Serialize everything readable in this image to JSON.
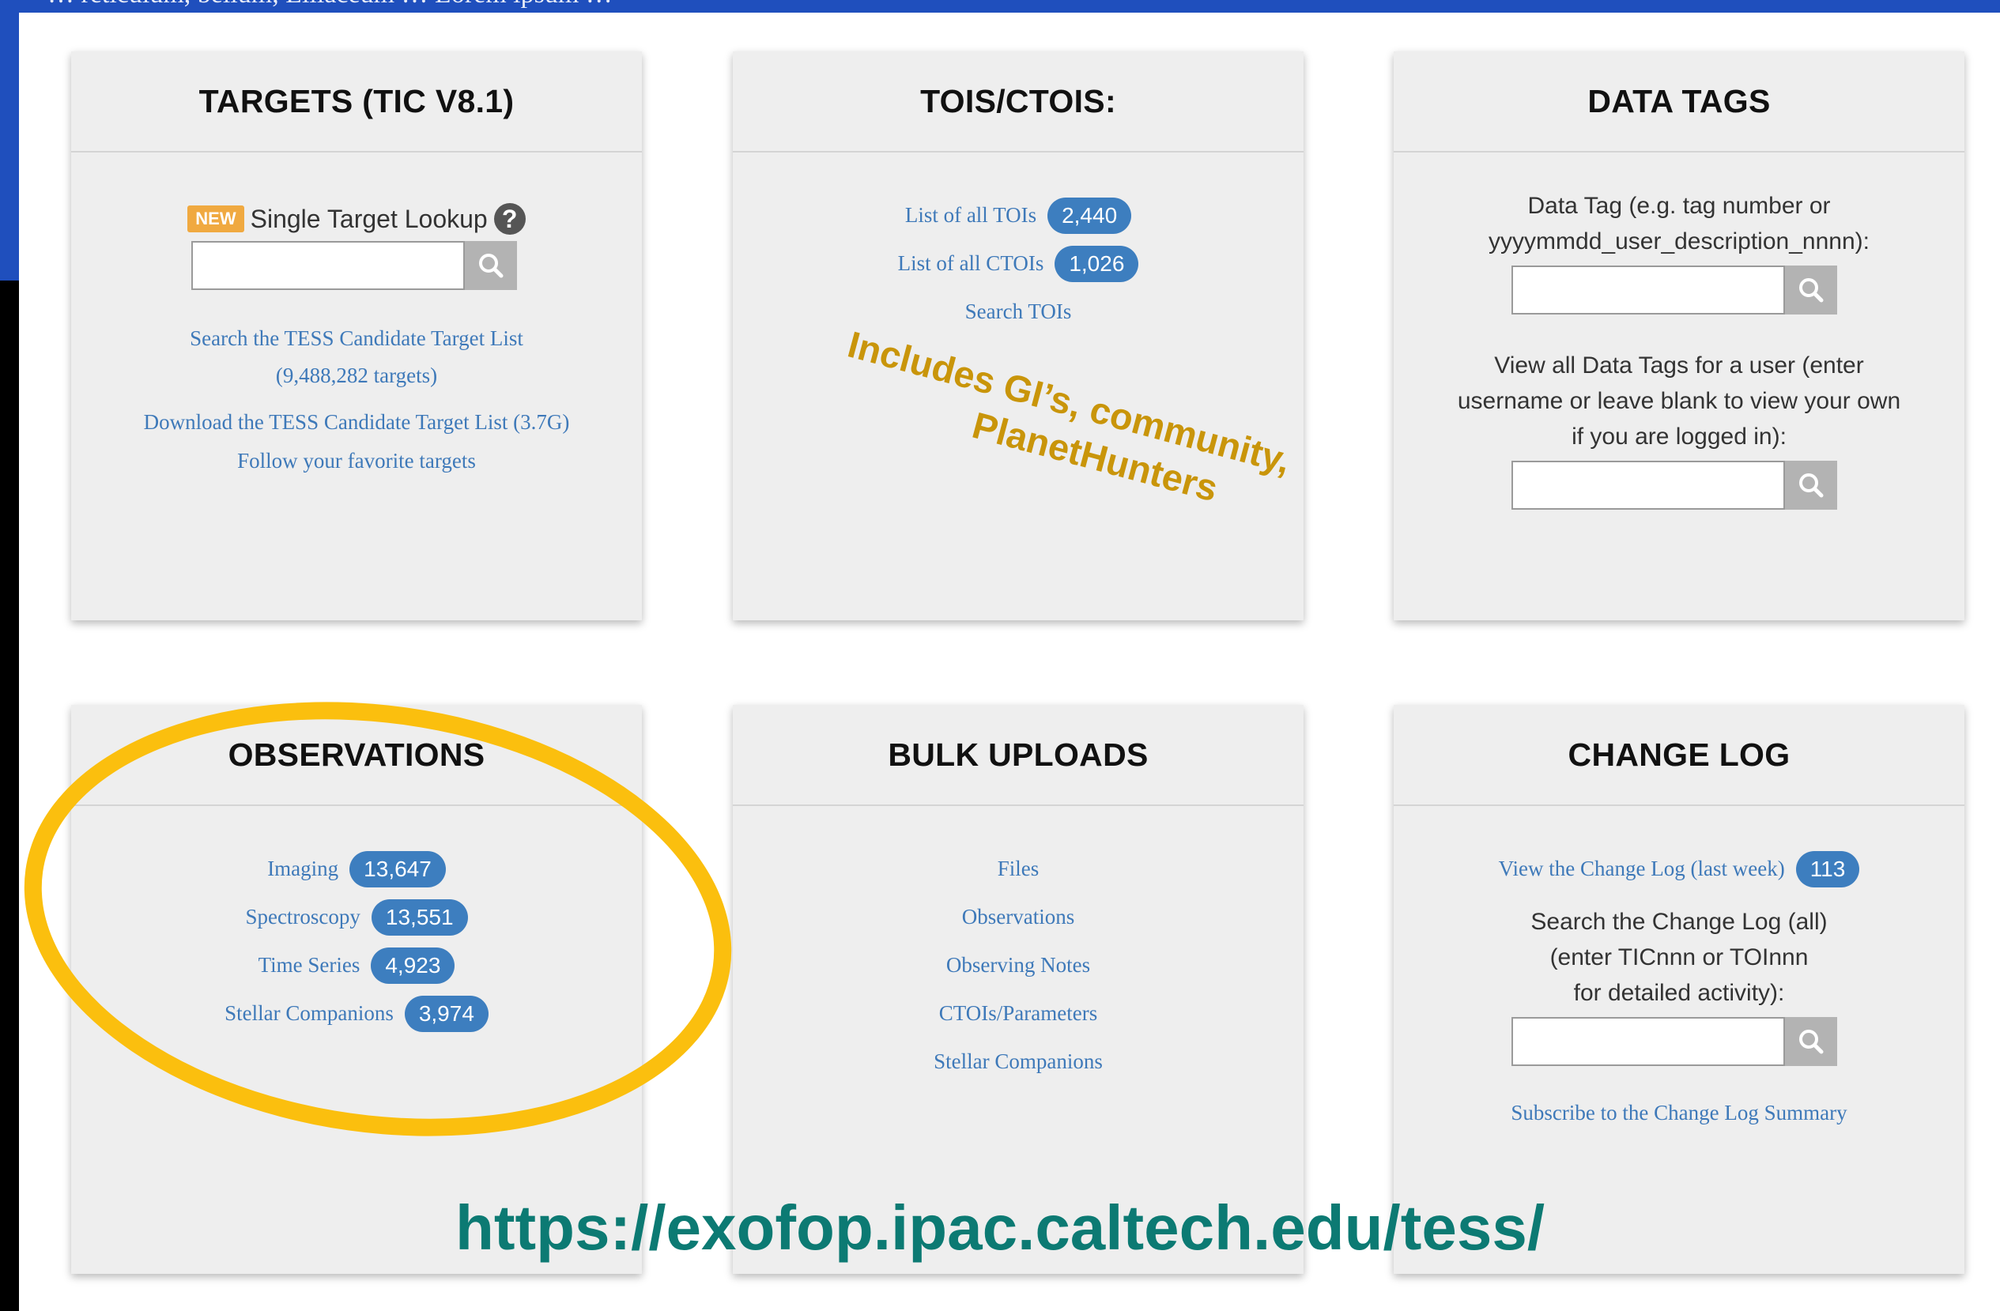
{
  "top_band_text": "… reticulum, bellum, Liliaceum … Lorem ipsum …",
  "accent_colors": {
    "brand_blue": "#1f4fbd",
    "link": "#3e79b9",
    "badge": "#3d7ebf",
    "annotation": "#c9950a",
    "ellipse": "#fbbf0e",
    "url": "#0c7a73"
  },
  "targets": {
    "title": "TARGETS (TIC V8.1)",
    "new_label": "NEW",
    "lookup_label": "Single Target Lookup",
    "help_icon": "?",
    "search_input_value": "",
    "search_ctl_link": "Search the TESS Candidate Target List",
    "search_ctl_count": "(9,488,282 targets)",
    "download_link": "Download the TESS Candidate Target List (3.7G)",
    "follow_link": "Follow your favorite targets"
  },
  "tois": {
    "title": "TOIS/CTOIS:",
    "items": [
      {
        "label": "List of all TOIs",
        "count": "2,440"
      },
      {
        "label": "List of all CTOIs",
        "count": "1,026"
      }
    ],
    "search_link": "Search TOIs",
    "annotation_line1": "Includes GI’s, community,",
    "annotation_line2": "PlanetHunters"
  },
  "data_tags": {
    "title": "DATA TAGS",
    "tag_prompt_line1": "Data Tag (e.g. tag number or",
    "tag_prompt_line2": "yyyymmdd_user_description_nnnn):",
    "tag_input_value": "",
    "user_prompt_line1": "View all Data Tags for a user (enter",
    "user_prompt_line2": "username or leave blank to view your own",
    "user_prompt_line3": "if you are logged in):",
    "user_input_value": ""
  },
  "observations": {
    "title": "OBSERVATIONS",
    "items": [
      {
        "label": "Imaging",
        "count": "13,647"
      },
      {
        "label": "Spectroscopy",
        "count": "13,551"
      },
      {
        "label": "Time Series",
        "count": "4,923"
      },
      {
        "label": "Stellar Companions",
        "count": "3,974"
      }
    ]
  },
  "bulk_uploads": {
    "title": "BULK UPLOADS",
    "items": [
      "Files",
      "Observations",
      "Observing Notes",
      "CTOIs/Parameters",
      "Stellar Companions"
    ]
  },
  "change_log": {
    "title": "CHANGE LOG",
    "view_link": "View the Change Log (last week)",
    "view_count": "113",
    "search_line1": "Search the Change Log (all)",
    "search_line2": "(enter TICnnn or TOInnn",
    "search_line3": "for detailed activity):",
    "search_input_value": "",
    "subscribe_link": "Subscribe to the Change Log Summary"
  },
  "url_caption": "https://exofop.ipac.caltech.edu/tess/",
  "icons": {
    "search": "search-icon",
    "help": "help-icon"
  }
}
